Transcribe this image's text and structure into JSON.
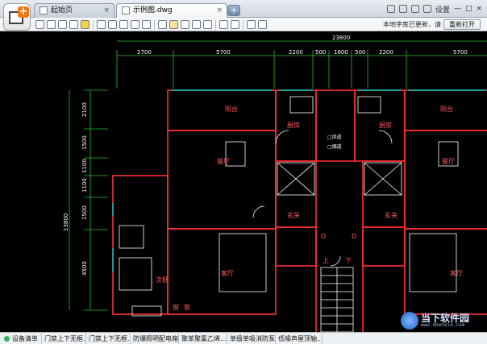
{
  "tabs": [
    {
      "label": "起始页",
      "close": "×"
    },
    {
      "label": "示例图.dwg",
      "close": "×"
    }
  ],
  "new_tab_label": "+",
  "system_icons": {
    "settings_label": "设置",
    "icons": [
      "skin-icon",
      "feedback-icon",
      "phone-icon",
      "lock-icon",
      "minimize-icon",
      "maximize-icon",
      "close-icon"
    ],
    "minimize": "—",
    "maximize": "□",
    "close": "×"
  },
  "toolbar": {
    "notice": "本地字库已更新，请",
    "reopen_label": "重新打开",
    "icons": [
      "open-icon",
      "save-icon",
      "print-icon",
      "export-icon",
      "lock-icon",
      "undo-icon",
      "zoom-window-icon",
      "zoom-extent-icon",
      "zoom-icon",
      "pan-icon",
      "text-icon",
      "pen-icon",
      "measure-icon",
      "back-icon",
      "forward-icon",
      "line-icon",
      "layer-icon",
      "layers-icon",
      "user-icon"
    ]
  },
  "drawing": {
    "overall_dimension": "23800",
    "dim_top": [
      "2700",
      "5700",
      "2200",
      "500",
      "1600",
      "500",
      "2200",
      "5700"
    ],
    "dim_left": [
      "2100",
      "1500",
      "1100",
      "1100",
      "1500",
      "4500"
    ],
    "dim_left_total": "13800",
    "rooms": {
      "balcony_left": "阳台",
      "balcony_right": "阳台",
      "kitchen_left": "厨房",
      "kitchen_right": "厨房",
      "dining_left": "餐厅",
      "dining_right": "餐厅",
      "entrance_left": "玄关",
      "entrance_right": "玄关",
      "bedroom": "次卧",
      "living_left": "客厅",
      "living_right": "客厅",
      "shaft_top": "□风道",
      "shaft_bottom": "□烟道",
      "stairs_up": "上",
      "stairs_down": "下",
      "stairs_d": "D",
      "stairs_d2": "D",
      "window_label": "窗",
      "window_label2": "窗"
    }
  },
  "statusbar": {
    "items": [
      "设备清单",
      "门禁上下无框...",
      "门禁上下无框...",
      "防爆照明配电箱",
      "聚苯聚氯乙烯...",
      "单级单吸消防泵",
      "低噪声屋顶轴..."
    ]
  },
  "watermark": {
    "title": "当下软件园",
    "subtitle": "www.downxia.com"
  },
  "colors": {
    "wall": "#ff3030",
    "dim": "#22c12a",
    "fixture": "#ffffff",
    "window": "#00c9c9",
    "text_room": "#ff5a5a"
  }
}
